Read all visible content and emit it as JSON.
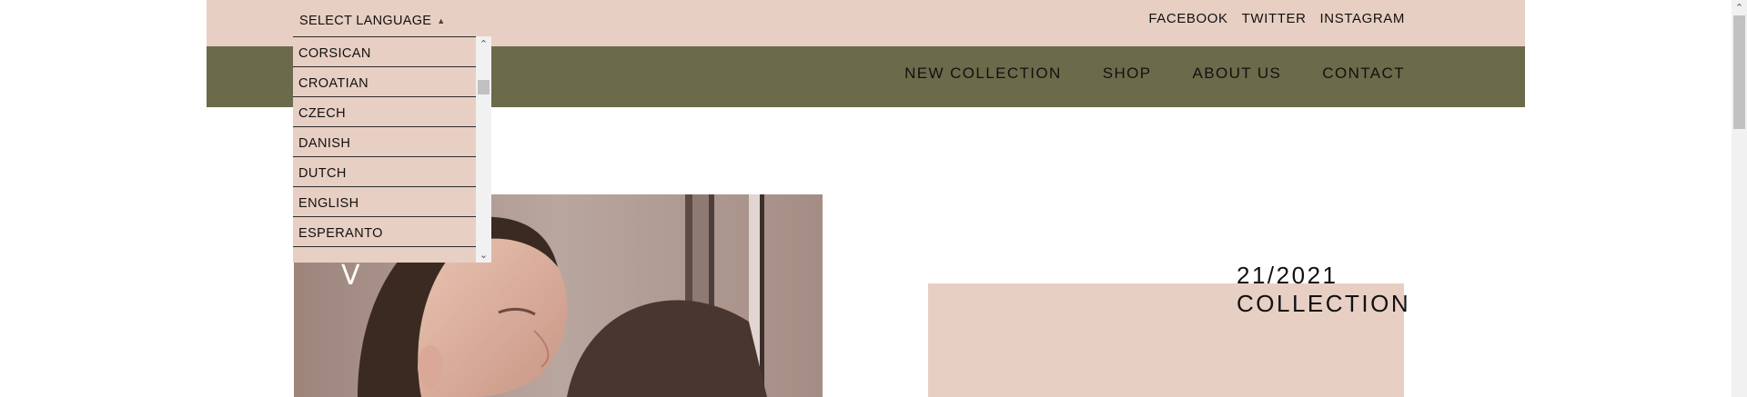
{
  "header": {
    "language_label": "SELECT LANGUAGE",
    "caret_icon": "triangle-up-icon",
    "social_links": [
      "FACEBOOK",
      "TWITTER",
      "INSTAGRAM"
    ]
  },
  "nav": {
    "items": [
      "NEW COLLECTION",
      "SHOP",
      "ABOUT US",
      "CONTACT"
    ]
  },
  "language_dropdown": {
    "options": [
      "CORSICAN",
      "CROATIAN",
      "CZECH",
      "DANISH",
      "DUTCH",
      "ENGLISH",
      "ESPERANTO",
      ""
    ]
  },
  "hero": {
    "overlay_letter": "V",
    "collection_line1": "21/2021",
    "collection_line2": "COLLECTION"
  },
  "colors": {
    "topbar_bg": "#e8cfc3",
    "navbar_bg": "#6b6b4b",
    "text": "#111111"
  }
}
